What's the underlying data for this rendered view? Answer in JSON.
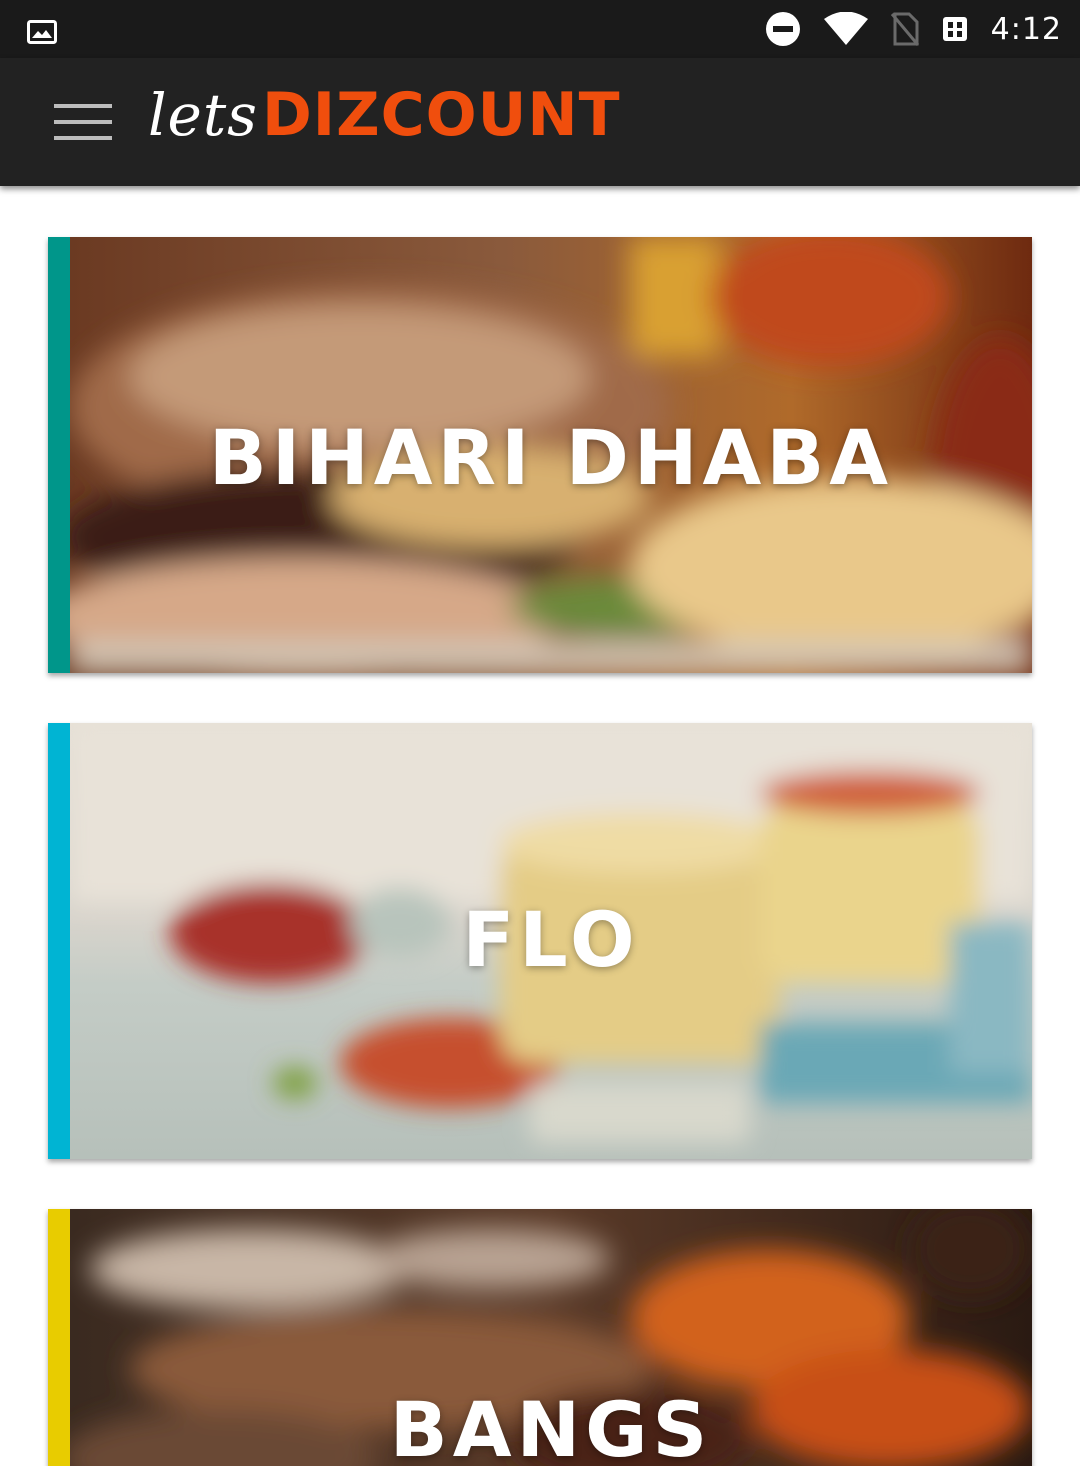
{
  "status_bar": {
    "time": "4:12",
    "icons": [
      "gallery-notification-icon",
      "do-not-disturb-icon",
      "wifi-icon",
      "no-sim-icon",
      "vibrate-icon"
    ]
  },
  "app_bar": {
    "menu_icon": "hamburger-menu-icon",
    "logo_prefix": "lets",
    "logo_brand": "DIZCOUNT",
    "brand_color": "#f04e0d"
  },
  "restaurants": [
    {
      "name": "BIHARI DHABA",
      "accent_color": "#00968a",
      "image": "blurred-burger-and-fries"
    },
    {
      "name": "FLO",
      "accent_color": "#00b4d3",
      "image": "blurred-smoothies"
    },
    {
      "name": "BANGS",
      "accent_color": "#e8cc00",
      "image": "blurred-grilled-food"
    }
  ]
}
